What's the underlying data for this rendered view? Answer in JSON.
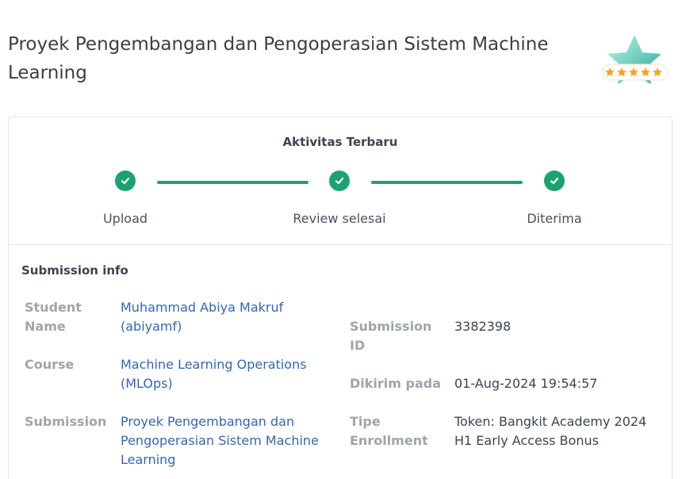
{
  "page": {
    "title": "Proyek Pengembangan dan Pengoperasian Sistem Machine Learning"
  },
  "activity": {
    "title": "Aktivitas Terbaru",
    "steps": [
      {
        "label": "Upload"
      },
      {
        "label": "Review selesai"
      },
      {
        "label": "Diterima"
      }
    ],
    "accent_color": "#1aa36f"
  },
  "submission_info": {
    "title": "Submission info",
    "student_name_label": "Student Name",
    "student_name_value": "Muhammad Abiya Makruf (abiyamf)",
    "course_label": "Course",
    "course_value": "Machine Learning Operations (MLOps)",
    "submission_label": "Submission",
    "submission_value": "Proyek Pengembangan dan Pengoperasian Sistem Machine Learning",
    "submission_id_label": "Submission ID",
    "submission_id_value": "3382398",
    "sent_at_label": "Dikirim pada",
    "sent_at_value": "01-Aug-2024 19:54:57",
    "enrollment_type_label": "Tipe Enrollment",
    "enrollment_type_value": "Token: Bangkit Academy 2024 H1 Early Access Bonus"
  },
  "rating": {
    "stars": 5,
    "icon": "star-badge-icon"
  }
}
